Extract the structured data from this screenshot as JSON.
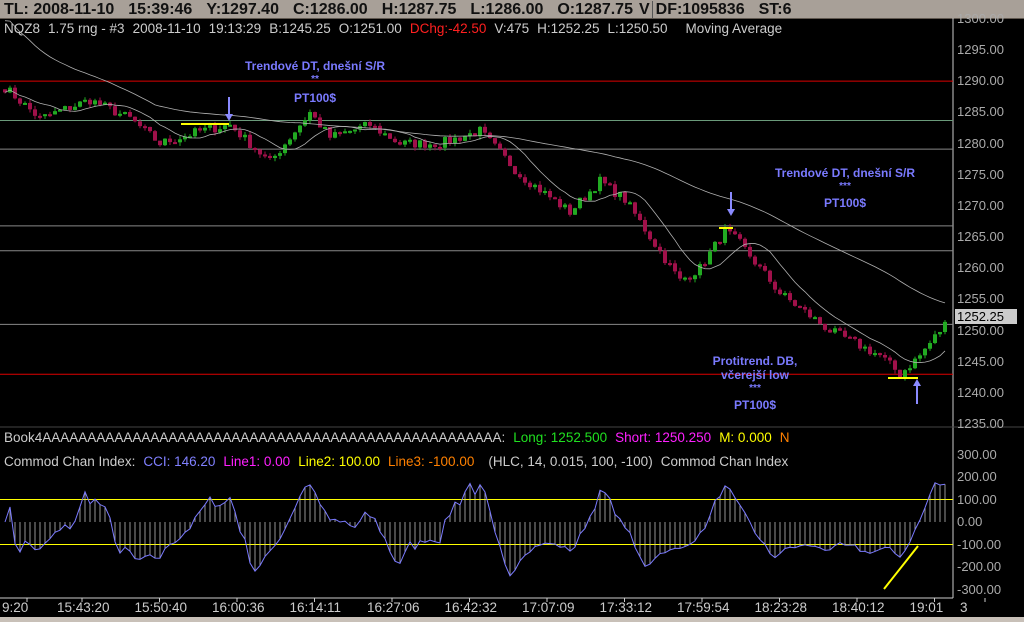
{
  "topbar": {
    "tl": "TL: 2008-11-10",
    "time": "15:39:46",
    "y": "Y:1297.40",
    "c": "C:1286.00",
    "h": "H:1287.75",
    "l": "L:1286.00",
    "o": "O:1287.75",
    "v": "V",
    "df": "DF:1095836",
    "st": "ST:6"
  },
  "header": {
    "symbol": "NQZ8",
    "bars": "1.75 rng - #3",
    "date": "2008-11-10",
    "time": "19:13:29",
    "bid": "B:1245.25",
    "open": "O:1251.00",
    "dchg": "DChg:-42.50",
    "vol": "V:475",
    "high": "H:1252.25",
    "low": "L:1250.50",
    "study": "Moving Average"
  },
  "book": {
    "name": "Book4AAAAAAAAAAAAAAAAAAAAAAAAAAAAAAAAAAAAAAAAAAAAAAAAAAA:",
    "long": "Long: 1252.500",
    "short": "Short: 1250.250",
    "m": "M: 0.000",
    "n": "N"
  },
  "cci_header": {
    "name": "Commod Chan Index:",
    "cci": "CCI: 146.20",
    "line1": "Line1: 0.00",
    "line2": "Line2: 100.00",
    "line3": "Line3: -100.00",
    "params": "(HLC, 14, 0.015, 100, -100)",
    "name2": "Commod Chan Index"
  },
  "annotations": [
    {
      "title": "Trendové DT, dnešní S/R",
      "stars": "**",
      "target": "PT100$"
    },
    {
      "title": "Trendové DT, dnešní S/R",
      "stars": "***",
      "target": "PT100$"
    },
    {
      "title1": "Protitrend. DB,",
      "title2": "včerejší low",
      "stars": "***",
      "target": "PT100$"
    }
  ],
  "current_price": "1252.25",
  "colors": {
    "up": "#22aa22",
    "down": "#a0104a",
    "ma": "#b0b0b0",
    "red_line": "#dd0000",
    "yellow": "#ffff00",
    "cci": "#7a7aff"
  },
  "chart_data": {
    "type": "candlestick",
    "price_axis": [
      "1300.00",
      "1295.00",
      "1290.00",
      "1285.00",
      "1280.00",
      "1275.00",
      "1270.00",
      "1265.00",
      "1260.00",
      "1255.00",
      "1250.00",
      "1245.00",
      "1240.00",
      "1235.00"
    ],
    "ylim": [
      1235,
      1300
    ],
    "levels": [
      {
        "price": 1290,
        "color": "#dd0000"
      },
      {
        "price": 1283.7,
        "color": "#6a9a7a"
      },
      {
        "price": 1279.1,
        "color": "#888"
      },
      {
        "price": 1266.8,
        "color": "#888"
      },
      {
        "price": 1262.8,
        "color": "#888"
      },
      {
        "price": 1251,
        "color": "#888"
      },
      {
        "price": 1243,
        "color": "#dd0000"
      }
    ],
    "close_waypoints": [
      [
        0,
        1289
      ],
      [
        7,
        1284
      ],
      [
        17,
        1287
      ],
      [
        25,
        1284
      ],
      [
        31,
        1280
      ],
      [
        39,
        1282
      ],
      [
        45,
        1283
      ],
      [
        53,
        1277
      ],
      [
        61,
        1285
      ],
      [
        65,
        1281
      ],
      [
        73,
        1283
      ],
      [
        79,
        1280
      ],
      [
        87,
        1280
      ],
      [
        95,
        1282
      ],
      [
        103,
        1275
      ],
      [
        113,
        1269
      ],
      [
        119,
        1274
      ],
      [
        124,
        1271
      ],
      [
        135,
        1258
      ],
      [
        139,
        1260
      ],
      [
        144,
        1266
      ],
      [
        147,
        1264
      ],
      [
        155,
        1256
      ],
      [
        165,
        1250
      ],
      [
        175,
        1246
      ],
      [
        179,
        1243
      ],
      [
        183,
        1246
      ],
      [
        188,
        1251
      ]
    ],
    "cci_axis": [
      "300.00",
      "200.00",
      "100.00",
      "0.00",
      "-100.00",
      "-200.00",
      "-300.00"
    ],
    "cci_ylim": [
      -300,
      300
    ],
    "time_labels": [
      "9:20",
      "15:43:20",
      "15:50:40",
      "16:00:36",
      "16:14:11",
      "16:27:06",
      "16:42:32",
      "17:07:09",
      "17:33:12",
      "17:59:54",
      "18:23:28",
      "18:40:12",
      "19:01",
      "3"
    ]
  }
}
